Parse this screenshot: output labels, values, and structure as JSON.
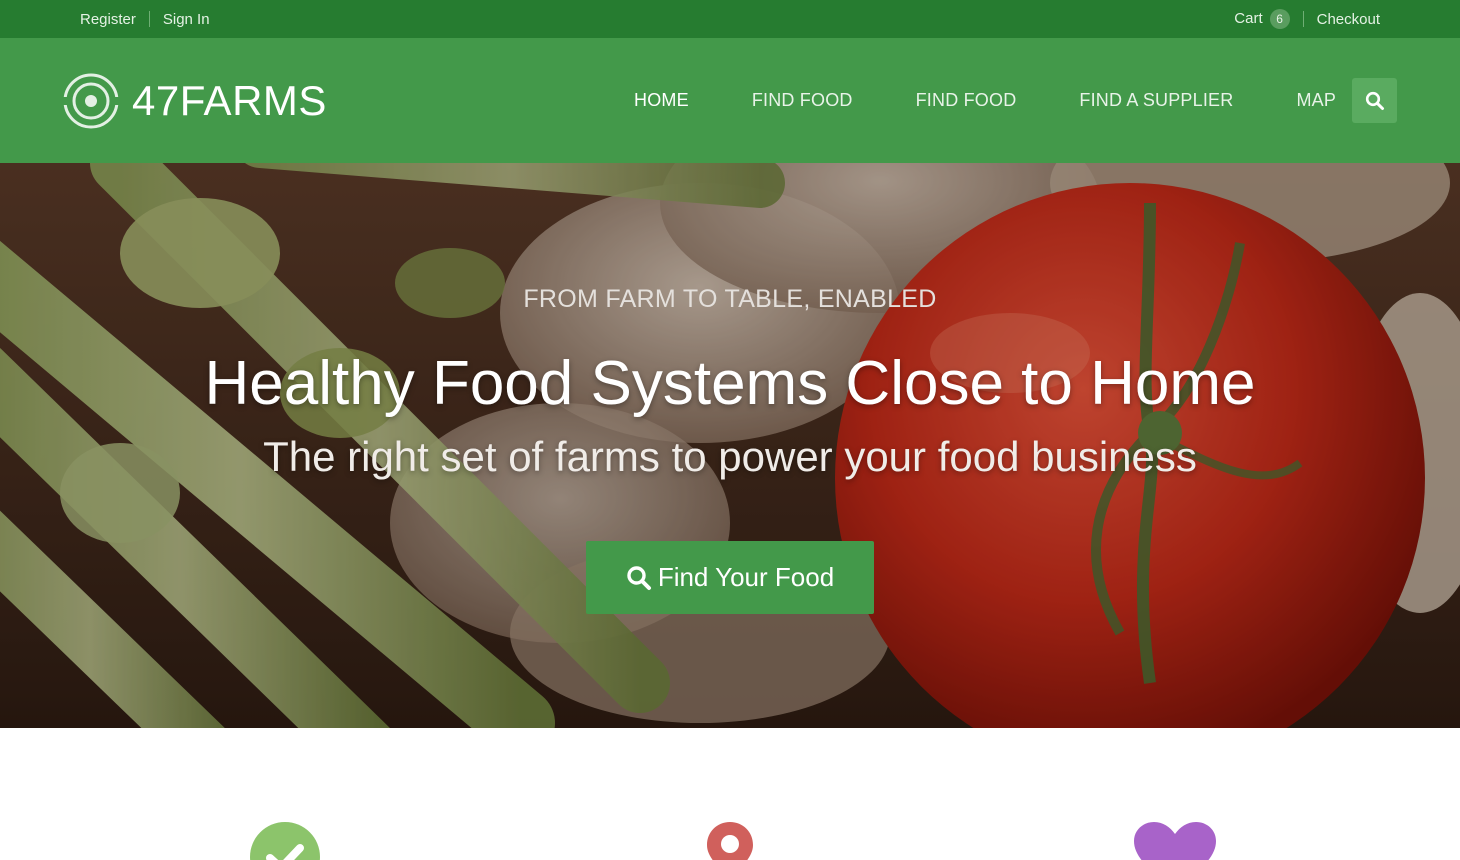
{
  "topbar": {
    "register_label": "Register",
    "signin_label": "Sign In",
    "cart_label": "Cart",
    "cart_count": "6",
    "checkout_label": "Checkout"
  },
  "brand": {
    "name": "47FARMS",
    "icon": "target-logo-icon"
  },
  "nav": {
    "items": [
      {
        "label": "HOME",
        "active": true
      },
      {
        "label": "FIND FOOD",
        "active": false
      },
      {
        "label": "FIND FOOD",
        "active": false
      },
      {
        "label": "FIND A SUPPLIER",
        "active": false
      },
      {
        "label": "MAP",
        "active": false
      }
    ],
    "search_icon": "search-icon"
  },
  "hero": {
    "kicker": "FROM FARM TO TABLE, ENABLED",
    "title": "Healthy Food Systems Close to Home",
    "subtitle": "The right set of farms to power your food business",
    "cta_label": "Find Your Food",
    "cta_icon": "search-icon"
  },
  "features": [
    {
      "icon": "checkmark-icon",
      "color": "#8cc46b"
    },
    {
      "icon": "map-pin-icon",
      "color": "#d0605c"
    },
    {
      "icon": "heart-icon",
      "color": "#a863c9"
    }
  ],
  "colors": {
    "topbar": "#267c30",
    "navbar": "#43994a",
    "accent": "#43994a"
  }
}
